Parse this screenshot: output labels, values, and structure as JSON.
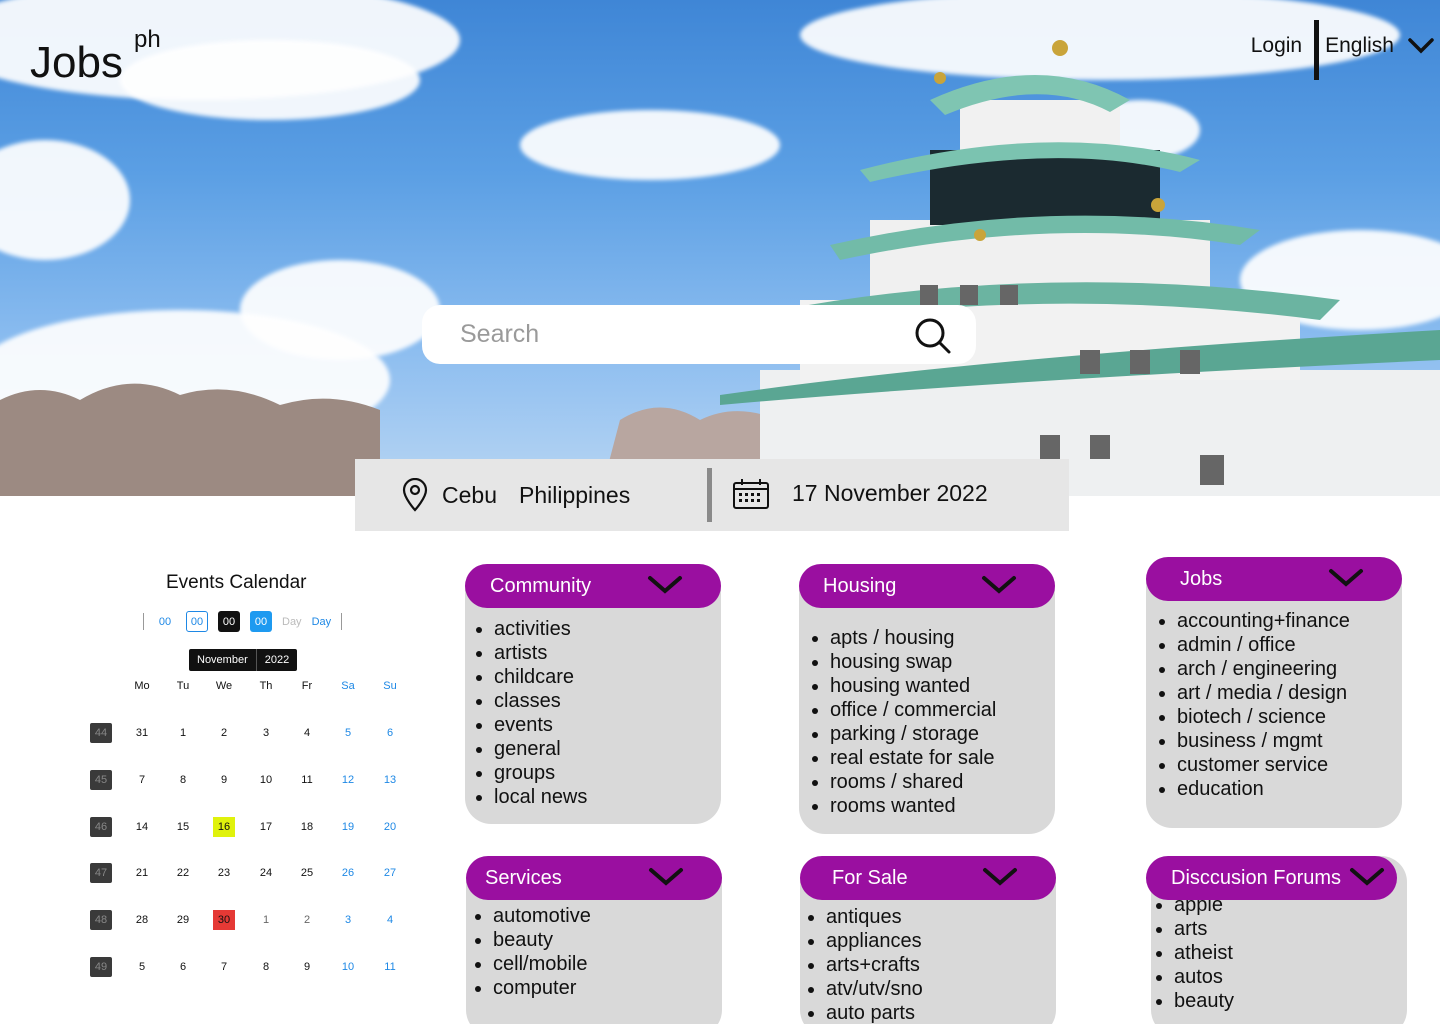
{
  "header": {
    "logo": "Jobs",
    "logo_sup": "ph",
    "login_label": "Login",
    "language": "English"
  },
  "search": {
    "placeholder": "Search"
  },
  "location": {
    "city": "Cebu",
    "country": "Philippines",
    "date": "17 November 2022"
  },
  "calendar": {
    "title": "Events Calendar",
    "controls": [
      "00",
      "00",
      "00",
      "00",
      "Day",
      "Day"
    ],
    "month": "November",
    "year": "2022",
    "weekdays": [
      "Mo",
      "Tu",
      "We",
      "Th",
      "Fr",
      "Sa",
      "Su"
    ],
    "weeks": [
      {
        "num": "44",
        "days": [
          "31",
          "1",
          "2",
          "3",
          "4",
          "5",
          "6"
        ]
      },
      {
        "num": "45",
        "days": [
          "7",
          "8",
          "9",
          "10",
          "11",
          "12",
          "13"
        ]
      },
      {
        "num": "46",
        "days": [
          "14",
          "15",
          "16",
          "17",
          "18",
          "19",
          "20"
        ]
      },
      {
        "num": "47",
        "days": [
          "21",
          "22",
          "23",
          "24",
          "25",
          "26",
          "27"
        ]
      },
      {
        "num": "48",
        "days": [
          "28",
          "29",
          "30",
          "1",
          "2",
          "3",
          "4"
        ]
      },
      {
        "num": "49",
        "days": [
          "5",
          "6",
          "7",
          "8",
          "9",
          "10",
          "11"
        ]
      }
    ],
    "highlight_today": "16",
    "highlight_red": "30",
    "colors": {
      "today": "#e0f20c",
      "red": "#e53935",
      "weekend": "#1e88e5"
    }
  },
  "categories": [
    {
      "title": "Community",
      "items": [
        "activities",
        "artists",
        "childcare",
        "classes",
        "events",
        "general",
        "groups",
        "local news"
      ]
    },
    {
      "title": "Housing",
      "items": [
        "apts / housing",
        "housing swap",
        "housing wanted",
        "office / commercial",
        "parking / storage",
        "real estate for sale",
        "rooms / shared",
        "rooms wanted"
      ]
    },
    {
      "title": "Jobs",
      "items": [
        "accounting+finance",
        "admin / office",
        "arch / engineering",
        "art / media / design",
        "biotech / science",
        "business / mgmt",
        "customer service",
        "education"
      ]
    },
    {
      "title": "Services",
      "items": [
        "automotive",
        "beauty",
        "cell/mobile",
        "computer"
      ]
    },
    {
      "title": "For Sale",
      "items": [
        "antiques",
        "appliances",
        "arts+crafts",
        "atv/utv/sno",
        "auto parts"
      ]
    },
    {
      "title": "Disccusion Forums",
      "items": [
        "apple",
        "arts",
        "atheist",
        "autos",
        "beauty"
      ]
    }
  ],
  "colors": {
    "accent": "#9a0fa0",
    "card_bg": "#d9d9d9",
    "location_bar": "#e6e6e6"
  }
}
